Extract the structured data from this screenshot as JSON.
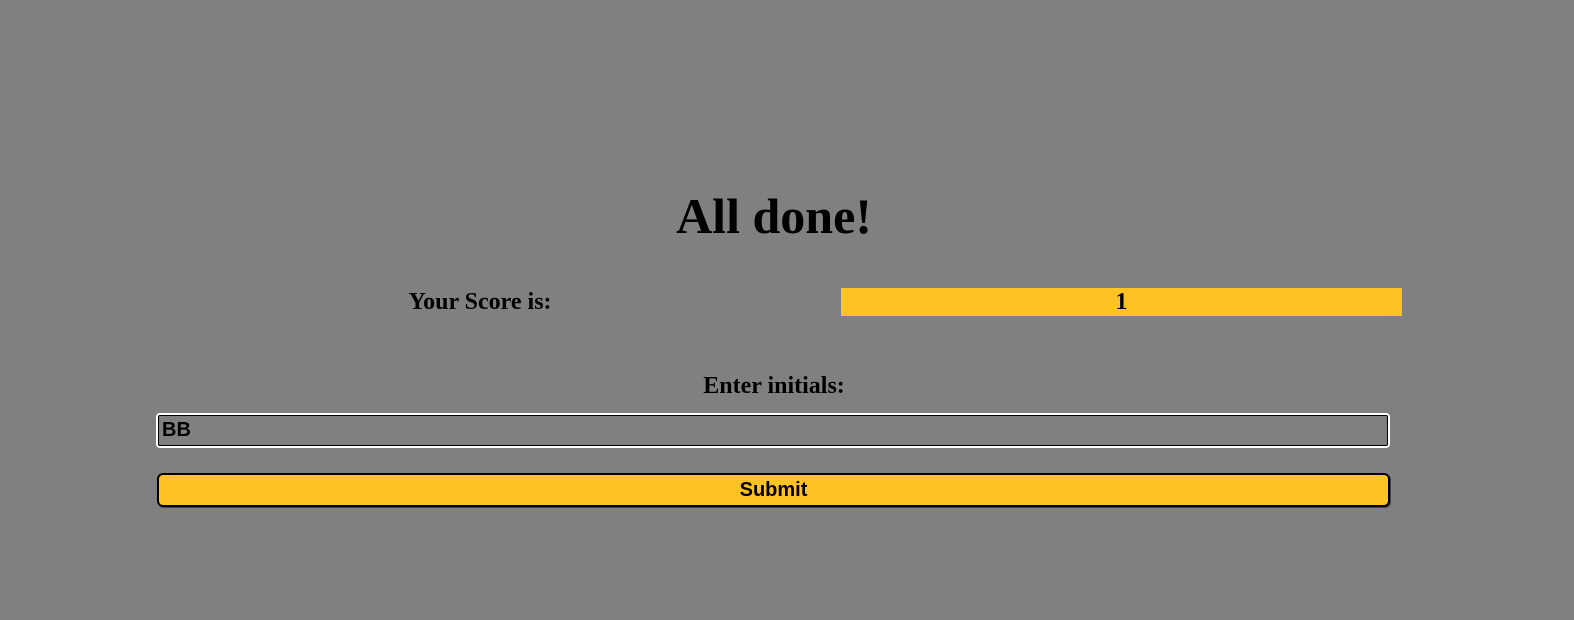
{
  "colors": {
    "background": "#808080",
    "accent": "#ffc225",
    "text": "#000000"
  },
  "result": {
    "title": "All done!",
    "score_label": "Your Score is:",
    "score_value": "1"
  },
  "form": {
    "initials_label": "Enter initials:",
    "initials_value": "BB",
    "submit_label": "Submit"
  }
}
